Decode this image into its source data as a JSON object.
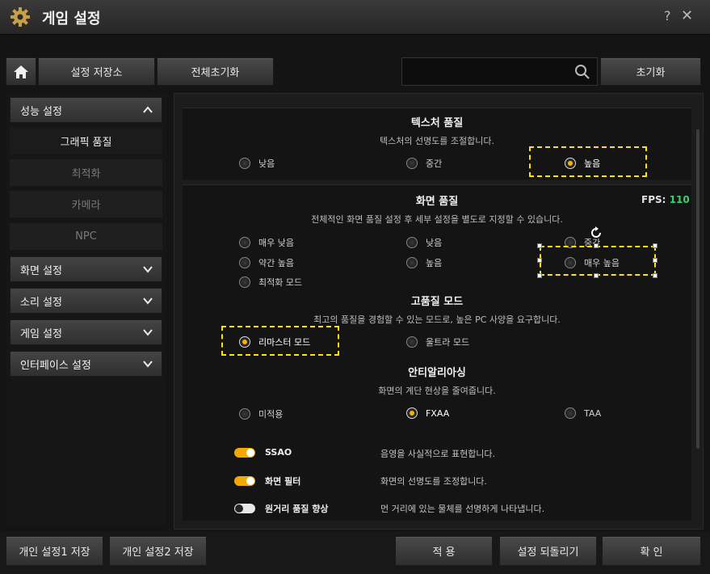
{
  "window": {
    "title": "게임 설정",
    "help": "?",
    "close": "✕"
  },
  "toolbar": {
    "home_icon": "home-icon",
    "save_store": "설정 저장소",
    "reset_all": "전체초기화",
    "search_placeholder": "",
    "reset": "초기화"
  },
  "sidebar": {
    "performance": "성능 설정",
    "sub": [
      "그래픽 품질",
      "최적화",
      "카메라",
      "NPC"
    ],
    "screen": "화면 설정",
    "sound": "소리 설정",
    "game": "게임 설정",
    "interface": "인터페이스 설정"
  },
  "texture": {
    "title": "텍스처 품질",
    "desc": "텍스처의 선명도를 조절합니다.",
    "options": [
      "낮음",
      "중간",
      "높음"
    ],
    "selected": "높음"
  },
  "screen_quality": {
    "title": "화면 품질",
    "fps_label": "FPS:",
    "fps_value": "110",
    "desc": "전체적인 화면 품질 설정 후 세부 설정을 별도로 지정할 수 있습니다.",
    "options": [
      "매우 낮음",
      "낮음",
      "중간",
      "약간 높음",
      "높음",
      "매우 높음",
      "최적화 모드"
    ]
  },
  "hq_mode": {
    "title": "고품질 모드",
    "desc": "최고의 품질을 경험할 수 있는 모드로, 높은 PC 사양을 요구합니다.",
    "options": [
      "리마스터 모드",
      "울트라 모드"
    ],
    "selected": "리마스터 모드"
  },
  "antialias": {
    "title": "안티알리아싱",
    "desc": "화면의 계단 현상을 줄여줍니다.",
    "options": [
      "미적용",
      "FXAA",
      "TAA"
    ],
    "selected": "FXAA"
  },
  "toggles": [
    {
      "label": "SSAO",
      "desc": "음영을 사실적으로 표현합니다.",
      "on": true
    },
    {
      "label": "화면 필터",
      "desc": "화면의 선명도를 조정합니다.",
      "on": true
    },
    {
      "label": "원거리 품질 향상",
      "desc": "먼 거리에 있는 물체를 선명하게 나타냅니다.",
      "on": false
    }
  ],
  "footer": {
    "save1": "개인 설정1 저장",
    "save2": "개인 설정2 저장",
    "apply": "적 용",
    "revert": "설정 되돌리기",
    "ok": "확 인"
  },
  "colors": {
    "accent": "#f3a800",
    "highlight": "#ffe500",
    "fps": "#36d36b"
  }
}
